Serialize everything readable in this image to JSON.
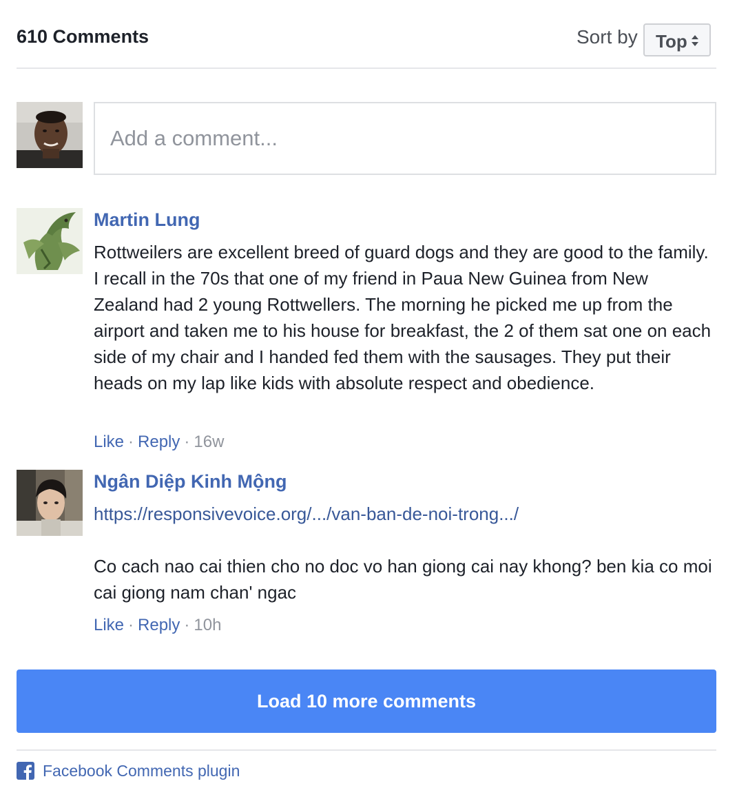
{
  "header": {
    "comment_count": "610 Comments",
    "sort_label": "Sort by",
    "sort_value": "Top"
  },
  "composer": {
    "placeholder": "Add a comment...",
    "avatar_icon": "user-avatar-photo"
  },
  "comments": [
    {
      "author": "Martin Lung",
      "avatar_icon": "dragon-avatar-photo",
      "link": "",
      "text": "Rottweilers are excellent breed of guard dogs and they are good to the family. I recall in the 70s that one of my friend in Paua New Guinea from New Zealand had 2 young Rottwellers. The morning he picked me up from the airport and taken me to his house for breakfast, the 2 of them sat one on each side of my chair and I handed fed them with the sausages. They put their heads on my lap like kids with absolute respect and obedience.",
      "like": "Like",
      "reply": "Reply",
      "time": "16w"
    },
    {
      "author": "Ngân Diệp Kinh Mộng",
      "avatar_icon": "person-avatar-photo",
      "link": "https://responsivevoice.org/.../van-ban-de-noi-trong.../",
      "text": "Co cach nao cai thien cho no doc vo han giong cai nay khong? ben kia co moi cai giong nam chan' ngac",
      "like": "Like",
      "reply": "Reply",
      "time": "10h"
    }
  ],
  "load_more": "Load 10 more comments",
  "footer": {
    "label": "Facebook Comments plugin",
    "icon": "facebook-icon"
  },
  "colors": {
    "link_blue": "#4267b2",
    "button_blue": "#4a86f5",
    "text": "#1d2129",
    "muted": "#90949c",
    "divider": "#e5e6e9"
  }
}
